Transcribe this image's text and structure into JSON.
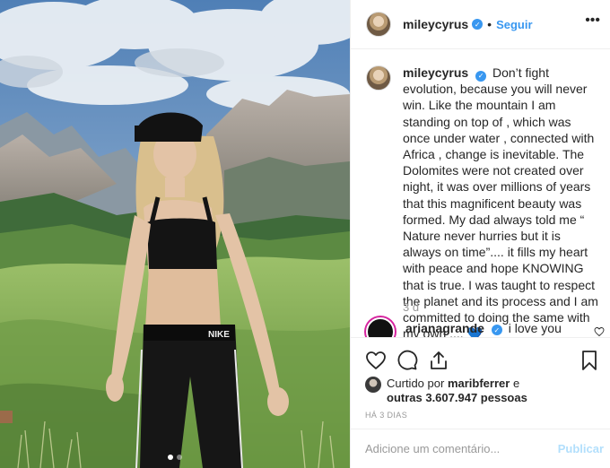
{
  "post": {
    "username": "mileycyrus",
    "follow_label": "Seguir",
    "separator": "•",
    "more_label": "•••",
    "caption_text": "Don’t fight evolution, because you will never win. Like the mountain I am standing on top of , which was once under water , connected with Africa , change is inevitable. The Dolomites were not created over night, it was over millions of years that this magnificent beauty was formed. My dad always told me “ Nature never hurries but it is always on time”.... it fills my heart with peace and hope KNOWING that is true. I was taught to respect the planet and its process and I am committed to doing the same with my own ....",
    "caption_emoji": "💙",
    "time_ago": "3 d",
    "photo_text": "NIKE",
    "carousel": {
      "count": 2,
      "active": 1
    }
  },
  "comment": {
    "username": "arianagrande",
    "text": "i love you"
  },
  "likes": {
    "prefix": "Curtido por",
    "first_user": "maribferrer",
    "mid": "e",
    "others": "outras 3.607.947 pessoas"
  },
  "posted_ago": "HÁ 3 DIAS",
  "add_comment": {
    "placeholder": "Adicione um comentário...",
    "publish_label": "Publicar"
  },
  "colors": {
    "accent": "#3897f0",
    "publish_disabled": "#b2dffc",
    "muted": "#999999",
    "border": "#efefef"
  },
  "icons": [
    "heart-icon",
    "comment-icon",
    "share-icon",
    "bookmark-icon",
    "verified-badge-icon",
    "more-options-icon"
  ]
}
